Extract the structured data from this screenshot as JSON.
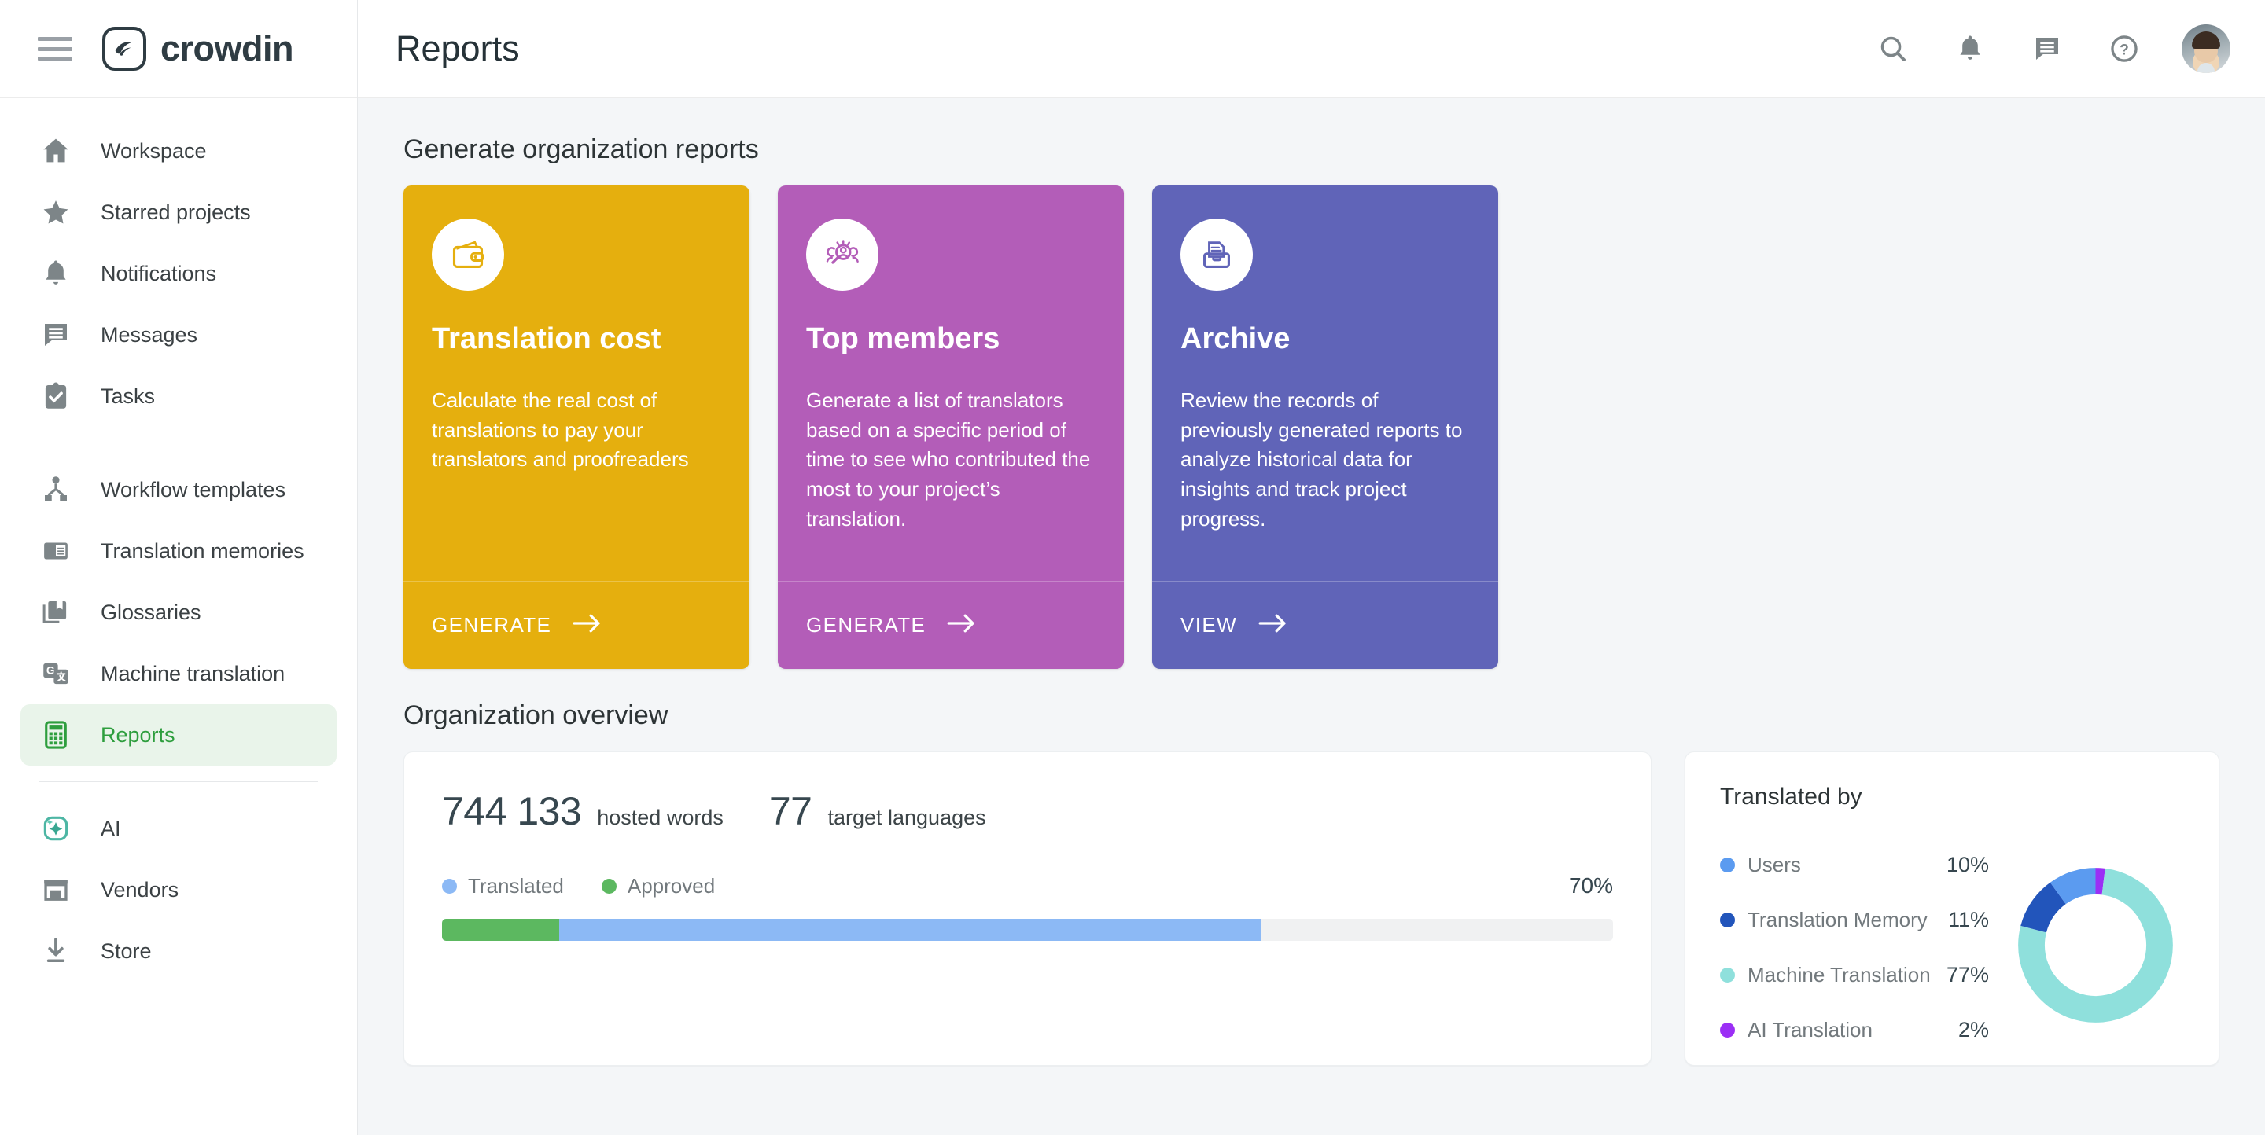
{
  "brand": {
    "name": "crowdin",
    "logo_icon": "crowdin-logo-icon",
    "menu_icon": "hamburger-menu-icon"
  },
  "header": {
    "title": "Reports",
    "actions": [
      {
        "name": "search-icon",
        "label": "Search"
      },
      {
        "name": "notifications-bell-icon",
        "label": "Notifications"
      },
      {
        "name": "messages-icon",
        "label": "Messages"
      },
      {
        "name": "help-question-icon",
        "label": "Help"
      }
    ],
    "avatar_label": "User avatar"
  },
  "sidebar": {
    "groups": [
      {
        "items": [
          {
            "label": "Workspace",
            "icon": "home-icon",
            "active": false
          },
          {
            "label": "Starred projects",
            "icon": "star-icon",
            "active": false
          },
          {
            "label": "Notifications",
            "icon": "bell-icon",
            "active": false
          },
          {
            "label": "Messages",
            "icon": "message-icon",
            "active": false
          },
          {
            "label": "Tasks",
            "icon": "clipboard-check-icon",
            "active": false
          }
        ]
      },
      {
        "items": [
          {
            "label": "Workflow templates",
            "icon": "workflow-icon",
            "active": false
          },
          {
            "label": "Translation memories",
            "icon": "translation-memory-icon",
            "active": false
          },
          {
            "label": "Glossaries",
            "icon": "glossary-book-icon",
            "active": false
          },
          {
            "label": "Machine translation",
            "icon": "machine-translation-icon",
            "active": false
          },
          {
            "label": "Reports",
            "icon": "calculator-icon",
            "active": true
          }
        ]
      },
      {
        "items": [
          {
            "label": "AI",
            "icon": "ai-sparkle-icon",
            "active": false
          },
          {
            "label": "Vendors",
            "icon": "store-icon",
            "active": false
          },
          {
            "label": "Store",
            "icon": "download-icon",
            "active": false
          }
        ]
      }
    ]
  },
  "main": {
    "generate_section_title": "Generate organization reports",
    "cards": [
      {
        "title": "Translation cost",
        "description": "Calculate the real cost of translations to pay your translators and proofreaders",
        "cta": "GENERATE",
        "color": "#E5AF0E",
        "icon": "wallet-icon"
      },
      {
        "title": "Top members",
        "description": "Generate a list of translators based on a specific period of time to see who contributed the most to your project’s translation.",
        "cta": "GENERATE",
        "color": "#B35DB8",
        "icon": "member-search-icon"
      },
      {
        "title": "Archive",
        "description": "Review the records of previously generated reports to analyze historical data for insights and track project progress.",
        "cta": "VIEW",
        "color": "#6064B8",
        "icon": "archive-box-icon"
      }
    ],
    "overview_section_title": "Organization overview",
    "overview": {
      "hosted_words_value": "744 133",
      "hosted_words_label": "hosted words",
      "target_languages_value": "77",
      "target_languages_label": "target languages",
      "legend": [
        {
          "label": "Translated",
          "color": "#8cb9f5"
        },
        {
          "label": "Approved",
          "color": "#5cb860"
        }
      ],
      "progress_percent_label": "70%"
    },
    "translated_by": {
      "title": "Translated by",
      "rows": [
        {
          "label": "Users",
          "percent": "10%",
          "color": "#5B9BF0"
        },
        {
          "label": "Translation Memory",
          "percent": "11%",
          "color": "#2255BB"
        },
        {
          "label": "Machine Translation",
          "percent": "77%",
          "color": "#8FE0DC"
        },
        {
          "label": "AI Translation",
          "percent": "2%",
          "color": "#9B2FF5"
        }
      ]
    }
  },
  "chart_data": [
    {
      "type": "bar",
      "title": "Organization overview progress",
      "categories": [
        "Approved",
        "Translated",
        "Remaining"
      ],
      "values": [
        10,
        60,
        30
      ],
      "series": [
        {
          "name": "Approved",
          "values": [
            10
          ],
          "color": "#5cb860"
        },
        {
          "name": "Translated",
          "values": [
            60
          ],
          "color": "#8cb9f5"
        }
      ],
      "total_percent": 70,
      "ylabel": "",
      "xlabel": "",
      "ylim": [
        0,
        100
      ],
      "legend": [
        "Translated",
        "Approved"
      ],
      "legend_position": "top-left",
      "grid": false
    },
    {
      "type": "pie",
      "title": "Translated by",
      "categories": [
        "Users",
        "Translation Memory",
        "Machine Translation",
        "AI Translation"
      ],
      "values": [
        10,
        11,
        77,
        2
      ],
      "colors": [
        "#5B9BF0",
        "#2255BB",
        "#8FE0DC",
        "#9B2FF5"
      ],
      "donut": true,
      "legend_position": "left",
      "grid": false
    }
  ]
}
